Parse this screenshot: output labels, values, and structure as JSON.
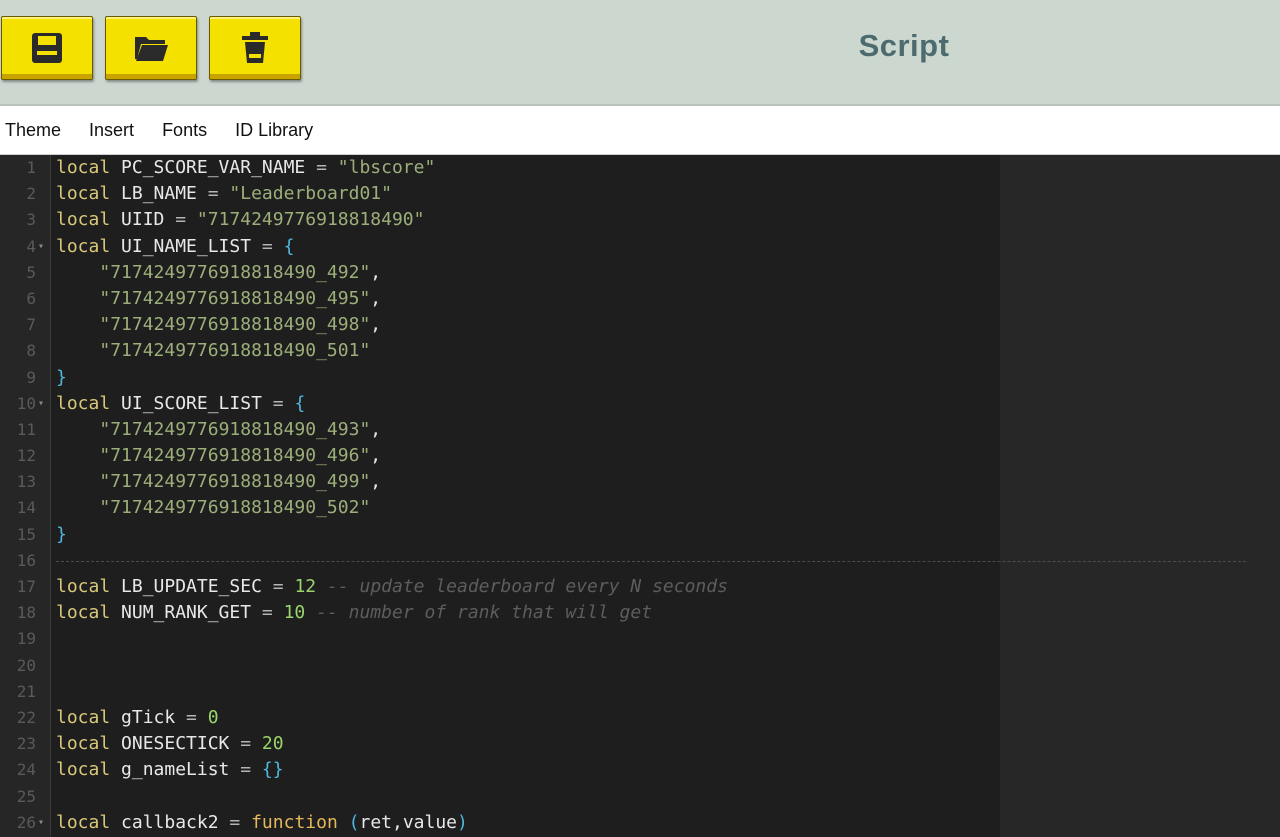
{
  "header": {
    "title": "Script",
    "buttons": [
      {
        "name": "save",
        "icon": "floppy-disk-icon"
      },
      {
        "name": "open",
        "icon": "folder-icon"
      },
      {
        "name": "delete",
        "icon": "trash-icon"
      }
    ]
  },
  "menu": {
    "items": [
      "Theme",
      "Insert",
      "Fonts",
      "ID Library"
    ]
  },
  "editor": {
    "lines": [
      {
        "n": "1",
        "code": "local PC_SCORE_VAR_NAME = \"lbscore\""
      },
      {
        "n": "2",
        "code": "local LB_NAME = \"Leaderboard01\""
      },
      {
        "n": "3",
        "code": "local UIID = \"7174249776918818490\""
      },
      {
        "n": "4",
        "code": "local UI_NAME_LIST = {",
        "fold": true
      },
      {
        "n": "5",
        "code": "    \"7174249776918818490_492\","
      },
      {
        "n": "6",
        "code": "    \"7174249776918818490_495\","
      },
      {
        "n": "7",
        "code": "    \"7174249776918818490_498\","
      },
      {
        "n": "8",
        "code": "    \"7174249776918818490_501\""
      },
      {
        "n": "9",
        "code": "}"
      },
      {
        "n": "10",
        "code": "local UI_SCORE_LIST = {",
        "fold": true
      },
      {
        "n": "11",
        "code": "    \"7174249776918818490_493\","
      },
      {
        "n": "12",
        "code": "    \"7174249776918818490_496\","
      },
      {
        "n": "13",
        "code": "    \"7174249776918818490_499\","
      },
      {
        "n": "14",
        "code": "    \"7174249776918818490_502\""
      },
      {
        "n": "15",
        "code": "}"
      },
      {
        "n": "16",
        "code": "",
        "separator": true
      },
      {
        "n": "17",
        "code": "local LB_UPDATE_SEC = 12 -- update leaderboard every N seconds"
      },
      {
        "n": "18",
        "code": "local NUM_RANK_GET = 10 -- number of rank that will get"
      },
      {
        "n": "19",
        "code": ""
      },
      {
        "n": "20",
        "code": ""
      },
      {
        "n": "21",
        "code": ""
      },
      {
        "n": "22",
        "code": "local gTick = 0"
      },
      {
        "n": "23",
        "code": "local ONESECTICK = 20"
      },
      {
        "n": "24",
        "code": "local g_nameList = {}"
      },
      {
        "n": "25",
        "code": ""
      },
      {
        "n": "26",
        "code": "local callback2 = function (ret,value)",
        "fold": true
      }
    ]
  },
  "colors": {
    "keyword": "#d9c879",
    "string": "#9caf7a",
    "bracket": "#4fb7e0",
    "number": "#9ad46a",
    "comment": "#5d5d5d",
    "button": "#f4e100"
  }
}
